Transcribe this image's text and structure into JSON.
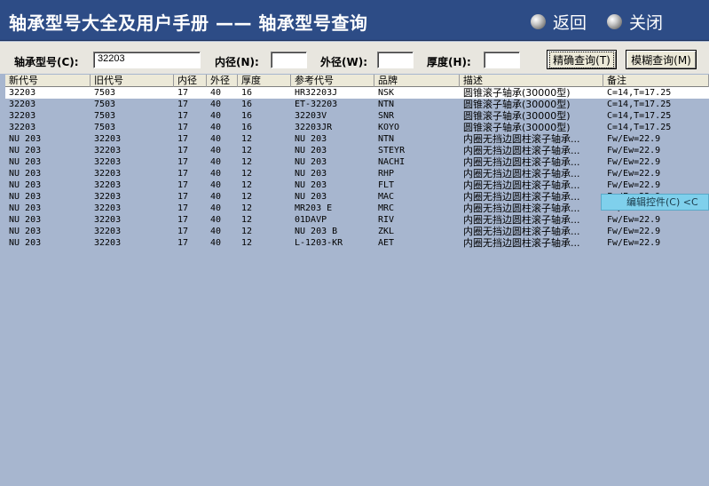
{
  "window": {
    "title": "轴承型号大全及用户手册 —— 轴承型号查询",
    "back_label": "返回",
    "close_label": "关闭"
  },
  "search": {
    "model_label": "轴承型号(C):",
    "model_value": "32203",
    "inner_label": "内径(N):",
    "inner_value": "",
    "outer_label": "外径(W):",
    "outer_value": "",
    "thick_label": "厚度(H):",
    "thick_value": "",
    "exact_button": "精确查询(T)",
    "fuzzy_button": "模糊查询(M)"
  },
  "table": {
    "columns": [
      "新代号",
      "旧代号",
      "内径",
      "外径",
      "厚度",
      "参考代号",
      "品牌",
      "描述",
      "备注"
    ],
    "rows": [
      [
        "32203",
        "7503",
        "17",
        "40",
        "16",
        "HR32203J",
        "NSK",
        "圆锥滚子轴承(30000型)",
        "C=14,T=17.25"
      ],
      [
        "32203",
        "7503",
        "17",
        "40",
        "16",
        "ET-32203",
        "NTN",
        "圆锥滚子轴承(30000型)",
        "C=14,T=17.25"
      ],
      [
        "32203",
        "7503",
        "17",
        "40",
        "16",
        "32203V",
        "SNR",
        "圆锥滚子轴承(30000型)",
        "C=14,T=17.25"
      ],
      [
        "32203",
        "7503",
        "17",
        "40",
        "16",
        "32203JR",
        "KOYO",
        "圆锥滚子轴承(30000型)",
        "C=14,T=17.25"
      ],
      [
        "NU 203",
        "32203",
        "17",
        "40",
        "12",
        "NU 203",
        "NTN",
        "内圈无挡边圆柱滚子轴承...",
        "Fw/Ew=22.9"
      ],
      [
        "NU 203",
        "32203",
        "17",
        "40",
        "12",
        "NU 203",
        "STEYR",
        "内圈无挡边圆柱滚子轴承...",
        "Fw/Ew=22.9"
      ],
      [
        "NU 203",
        "32203",
        "17",
        "40",
        "12",
        "NU 203",
        "NACHI",
        "内圈无挡边圆柱滚子轴承...",
        "Fw/Ew=22.9"
      ],
      [
        "NU 203",
        "32203",
        "17",
        "40",
        "12",
        "NU 203",
        "RHP",
        "内圈无挡边圆柱滚子轴承...",
        "Fw/Ew=22.9"
      ],
      [
        "NU 203",
        "32203",
        "17",
        "40",
        "12",
        "NU 203",
        "FLT",
        "内圈无挡边圆柱滚子轴承...",
        "Fw/Ew=22.9"
      ],
      [
        "NU 203",
        "32203",
        "17",
        "40",
        "12",
        "NU 203",
        "MAC",
        "内圈无挡边圆柱滚子轴承...",
        "Fw/Ew=22.9"
      ],
      [
        "NU 203",
        "32203",
        "17",
        "40",
        "12",
        "MR203 E",
        "MRC",
        "内圈无挡边圆柱滚子轴承...",
        "Fw/Ew=22.9"
      ],
      [
        "NU 203",
        "32203",
        "17",
        "40",
        "12",
        "01DAVP",
        "RIV",
        "内圈无挡边圆柱滚子轴承...",
        "Fw/Ew=22.9"
      ],
      [
        "NU 203",
        "32203",
        "17",
        "40",
        "12",
        "NU 203 B",
        "ZKL",
        "内圈无挡边圆柱滚子轴承...",
        "Fw/Ew=22.9"
      ],
      [
        "NU 203",
        "32203",
        "17",
        "40",
        "12",
        "L-1203-KR",
        "AET",
        "内圈无挡边圆柱滚子轴承...",
        "Fw/Ew=22.9"
      ]
    ],
    "selected_row": 0
  },
  "context_popup": {
    "label": "编辑控件(C)  <C"
  },
  "colors": {
    "titlebar": "#2d4c86",
    "grid_background": "#a7b6cf",
    "popup": "#7fd0ec"
  }
}
